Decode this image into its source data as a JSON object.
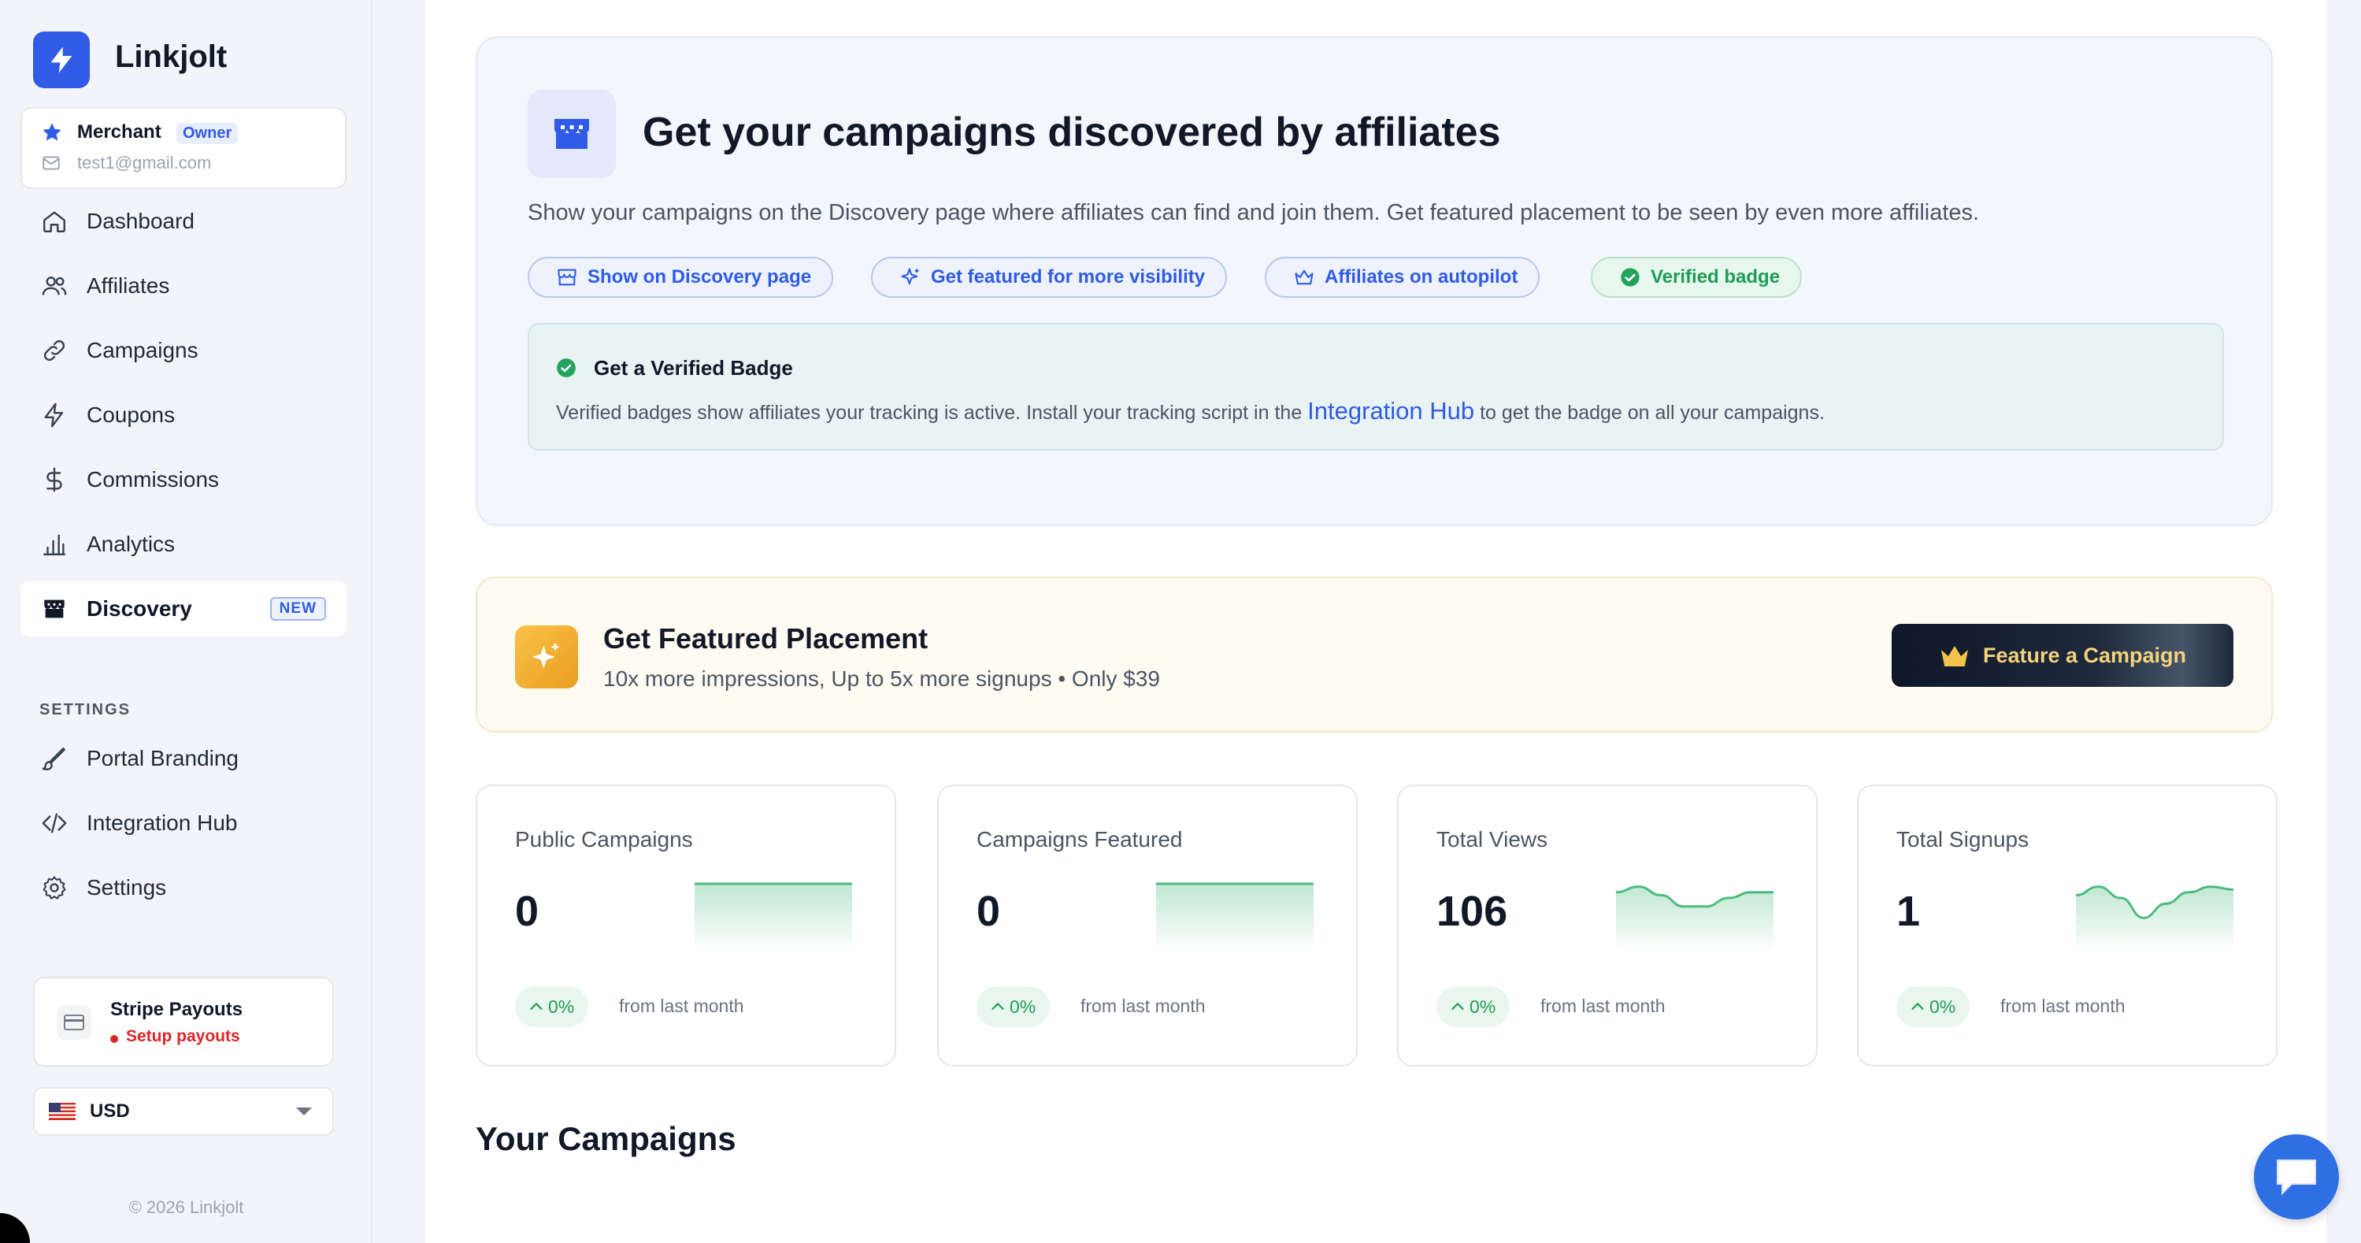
{
  "brand": {
    "name": "Linkjolt",
    "accent": "#2f5be6"
  },
  "account": {
    "role": "Merchant",
    "badge": "Owner",
    "email": "test1@gmail.com"
  },
  "nav": {
    "items": [
      {
        "label": "Dashboard",
        "icon": "home-icon"
      },
      {
        "label": "Affiliates",
        "icon": "users-icon"
      },
      {
        "label": "Campaigns",
        "icon": "link-icon"
      },
      {
        "label": "Coupons",
        "icon": "bolt-icon"
      },
      {
        "label": "Commissions",
        "icon": "dollar-icon"
      },
      {
        "label": "Analytics",
        "icon": "bar-chart-icon"
      },
      {
        "label": "Discovery",
        "icon": "store-icon",
        "badge": "NEW",
        "active": true
      }
    ],
    "settings_header": "SETTINGS",
    "settings_items": [
      {
        "label": "Portal Branding",
        "icon": "brush-icon"
      },
      {
        "label": "Integration Hub",
        "icon": "code-icon"
      },
      {
        "label": "Settings",
        "icon": "gear-icon"
      }
    ]
  },
  "stripe": {
    "title": "Stripe Payouts",
    "status": "Setup payouts"
  },
  "currency": {
    "selected": "USD",
    "flag": "us-flag-icon"
  },
  "footer": {
    "copyright": "© 2026 Linkjolt"
  },
  "hero": {
    "title": "Get your campaigns discovered by affiliates",
    "subtitle": "Show your campaigns on the Discovery page where affiliates can find and join them. Get featured placement to be seen by even more affiliates.",
    "pills": [
      {
        "label": "Show on Discovery page",
        "icon": "store-icon"
      },
      {
        "label": "Get featured for more visibility",
        "icon": "sparkle-icon"
      },
      {
        "label": "Affiliates on autopilot",
        "icon": "crown-icon"
      },
      {
        "label": "Verified badge",
        "icon": "check-circle-icon"
      }
    ],
    "verified": {
      "title": "Get a Verified Badge",
      "text_before": "Verified badges show affiliates your tracking is active. Install your tracking script in the",
      "link": "Integration Hub",
      "text_after": "to get the badge on all your campaigns."
    }
  },
  "featured": {
    "title": "Get Featured Placement",
    "subtitle": "10x more impressions, Up to 5x more signups • Only $39",
    "button": "Feature a Campaign"
  },
  "stats": [
    {
      "label": "Public Campaigns",
      "value": "0",
      "change": "0%",
      "from": "from last month",
      "trend": [
        1,
        1,
        1,
        1,
        1,
        1,
        1,
        1
      ]
    },
    {
      "label": "Campaigns Featured",
      "value": "0",
      "change": "0%",
      "from": "from last month",
      "trend": [
        1,
        1,
        1,
        1,
        1,
        1,
        1,
        1
      ]
    },
    {
      "label": "Total Views",
      "value": "106",
      "change": "0%",
      "from": "from last month",
      "trend": [
        0.85,
        0.95,
        0.8,
        0.6,
        0.6,
        0.75,
        0.85,
        0.85
      ]
    },
    {
      "label": "Total Signups",
      "value": "1",
      "change": "0%",
      "from": "from last month",
      "trend": [
        0.8,
        0.95,
        0.75,
        0.4,
        0.65,
        0.85,
        0.95,
        0.9
      ]
    }
  ],
  "section": {
    "your_campaigns": "Your Campaigns"
  },
  "colors": {
    "positive": "#1f9d55",
    "warning": "#dc2626",
    "gold": "#f5d37a"
  }
}
